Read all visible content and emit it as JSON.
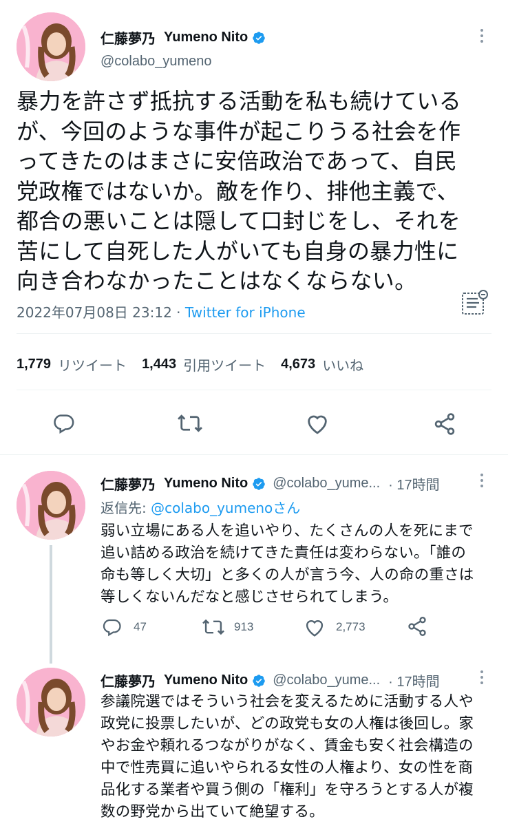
{
  "main_tweet": {
    "author_name_jp": "仁藤夢乃",
    "author_name_en": "Yumeno Nito",
    "handle": "@colabo_yumeno",
    "text_lines": [
      "暴力を許さず抵抗する活動を私も続けている",
      "が、今回のような事件が起こりうる社会を作",
      "ってきたのはまさに安倍政治であって、自民",
      "党政権ではないか。敵を作り、排他主義で、",
      "都合の悪いことは隠して口封じをし、それを",
      "苦にして自死した人がいても自身の暴力性に",
      "向き合わなかったことはなくならない。"
    ],
    "timestamp": "2022年07月08日 23:12",
    "separator": "·",
    "source": "Twitter for iPhone",
    "stats": {
      "retweets": "1,779",
      "retweets_label": "リツイート",
      "quotes": "1,443",
      "quotes_label": "引用ツイート",
      "likes": "4,673",
      "likes_label": "いいね"
    }
  },
  "replies": [
    {
      "author_name_jp": "仁藤夢乃",
      "author_name_en": "Yumeno Nito",
      "handle": "@colabo_yume...",
      "time": "· 17時間",
      "reply_to_prefix": "返信先: ",
      "reply_to_handle": "@colabo_yumenoさん",
      "text_lines": [
        "弱い立場にある人を追いやり、たくさんの人を死にまで",
        "追い詰める政治を続けてきた責任は変わらない。「誰の",
        "命も等しく大切」と多くの人が言う今、人の命の重さは",
        "等しくないんだなと感じさせられてしまう。"
      ],
      "reply_count": "47",
      "retweet_count": "913",
      "like_count": "2,773"
    },
    {
      "author_name_jp": "仁藤夢乃",
      "author_name_en": "Yumeno Nito",
      "handle": "@colabo_yume...",
      "time": "· 17時間",
      "text_lines": [
        "参議院選ではそういう社会を変えるために活動する人や",
        "政党に投票したいが、どの政党も女の人権は後回し。家",
        "やお金や頼れるつながりがなく、賃金も安く社会構造の",
        "中で性売買に追いやられる女性の人権より、女の性を商",
        "品化する業者や買う側の「権利」を守ろうとする人が複",
        "数の野党から出ていて絶望する。"
      ]
    }
  ],
  "colors": {
    "verified": "#1d9bf0",
    "link": "#1d9bf0",
    "muted": "#536471",
    "divider": "#eff3f4"
  },
  "icons": [
    "verified-badge-icon",
    "more-icon",
    "translate-icon",
    "reply-icon",
    "retweet-icon",
    "like-icon",
    "share-icon"
  ]
}
